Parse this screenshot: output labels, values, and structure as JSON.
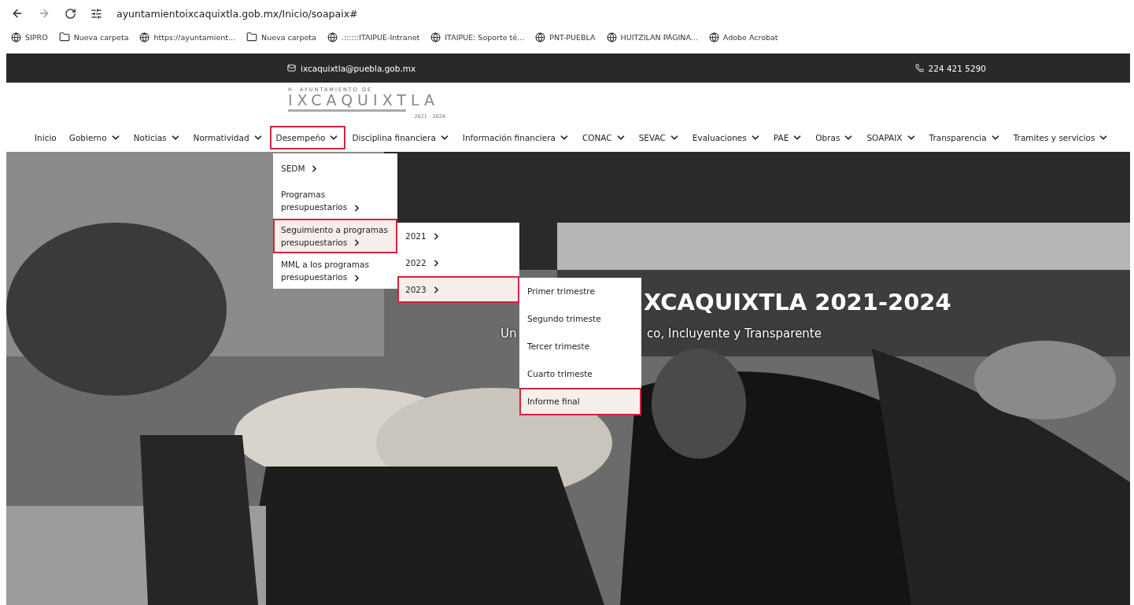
{
  "browser": {
    "url": "ayuntamientoixcaquixtla.gob.mx/Inicio/soapaix#"
  },
  "bookmarks": [
    {
      "kind": "site",
      "label": "SIPRO"
    },
    {
      "kind": "folder",
      "label": "Nueva carpeta"
    },
    {
      "kind": "site",
      "label": "https://ayuntamient..."
    },
    {
      "kind": "folder",
      "label": "Nueva carpeta"
    },
    {
      "kind": "site",
      "label": ".::::::ITAIPUE-Intranet"
    },
    {
      "kind": "site",
      "label": "ITAIPUE: Soporte té..."
    },
    {
      "kind": "site",
      "label": "PNT-PUEBLA"
    },
    {
      "kind": "site",
      "label": "HUITZILAN PÁGINA..."
    },
    {
      "kind": "site",
      "label": "Adobe Acrobat"
    }
  ],
  "top_bar": {
    "email": "ixcaquixtla@puebla.gob.mx",
    "phone": "224 421 5290"
  },
  "logo": {
    "overline": "H. AYUNTAMIENTO DE",
    "name": "IXCAQUIXTLA",
    "years": "2021 - 2024"
  },
  "nav": [
    {
      "label": "Inicio",
      "dropdown": false,
      "selected": false
    },
    {
      "label": "Gobierno",
      "dropdown": true,
      "selected": false
    },
    {
      "label": "Noticias",
      "dropdown": true,
      "selected": false
    },
    {
      "label": "Normatividad",
      "dropdown": true,
      "selected": false
    },
    {
      "label": "Desempeño",
      "dropdown": true,
      "selected": true
    },
    {
      "label": "Disciplina financiera",
      "dropdown": true,
      "selected": false
    },
    {
      "label": "Información financiera",
      "dropdown": true,
      "selected": false
    },
    {
      "label": "CONAC",
      "dropdown": true,
      "selected": false
    },
    {
      "label": "SEVAC",
      "dropdown": true,
      "selected": false
    },
    {
      "label": "Evaluaciones",
      "dropdown": true,
      "selected": false
    },
    {
      "label": "PAE",
      "dropdown": true,
      "selected": false
    },
    {
      "label": "Obras",
      "dropdown": true,
      "selected": false
    },
    {
      "label": "SOAPAIX",
      "dropdown": true,
      "selected": false
    },
    {
      "label": "Transparencia",
      "dropdown": true,
      "selected": false
    },
    {
      "label": "Tramites y servicios",
      "dropdown": true,
      "selected": false
    }
  ],
  "hero": {
    "kind": "picture",
    "title_fragment": "XCAQUIXTLA 2021-2024",
    "subtitle_start": "Un",
    "subtitle_fragment": "co, Incluyente y Transparente"
  },
  "menus": [
    {
      "items": [
        {
          "label": "SEDM",
          "submenu": true,
          "selected": false
        },
        {
          "label": "Programas presupuestarios",
          "submenu": true,
          "selected": false
        },
        {
          "label": "Seguimiento a programas presupuestarios",
          "submenu": true,
          "selected": true
        },
        {
          "label": "MML a los programas presupuestarios",
          "submenu": true,
          "selected": false
        }
      ]
    },
    {
      "items": [
        {
          "label": "2021",
          "submenu": true,
          "selected": false
        },
        {
          "label": "2022",
          "submenu": true,
          "selected": false
        },
        {
          "label": "2023",
          "submenu": true,
          "selected": true
        }
      ]
    },
    {
      "items": [
        {
          "label": "Primer trimestre",
          "submenu": false,
          "selected": false
        },
        {
          "label": "Segundo trimeste",
          "submenu": false,
          "selected": false
        },
        {
          "label": "Tercer trimeste",
          "submenu": false,
          "selected": false
        },
        {
          "label": "Cuarto trimeste",
          "submenu": false,
          "selected": false
        },
        {
          "label": "Informe final",
          "submenu": false,
          "selected": true
        }
      ]
    }
  ]
}
